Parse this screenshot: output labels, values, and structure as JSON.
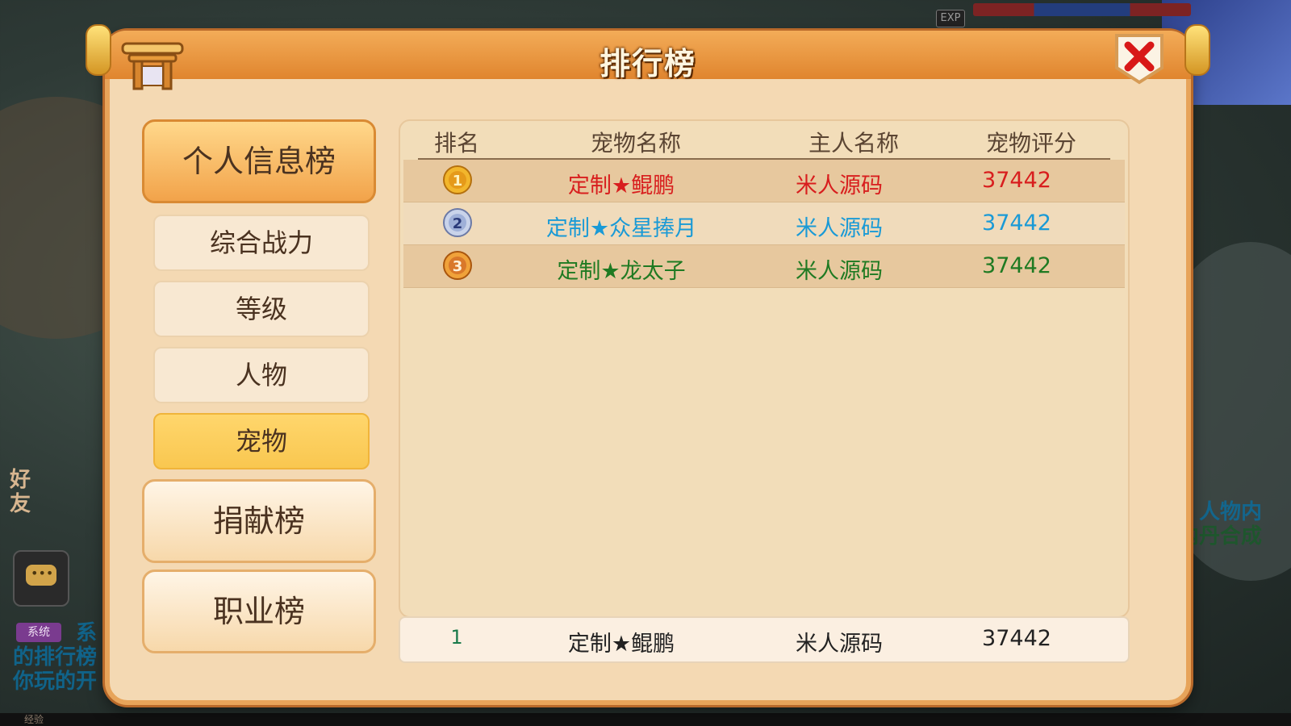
{
  "dialog": {
    "title": "排行榜"
  },
  "nav": {
    "personal_label": "个人信息榜",
    "sub_items": [
      "综合战力",
      "等级",
      "人物",
      "宠物"
    ],
    "active_sub": "宠物",
    "donation_label": "捐献榜",
    "career_label": "职业榜"
  },
  "table": {
    "headers": [
      "排名",
      "宠物名称",
      "主人名称",
      "宠物评分"
    ],
    "rows": [
      {
        "rank": "1",
        "pet": "定制★鲲鹏",
        "owner": "米人源码",
        "score": "37442",
        "color": "#d81e1e",
        "medal": "gold"
      },
      {
        "rank": "2",
        "pet": "定制★众星捧月",
        "owner": "米人源码",
        "score": "37442",
        "color": "#1a9ad6",
        "medal": "silver"
      },
      {
        "rank": "3",
        "pet": "定制★龙太子",
        "owner": "米人源码",
        "score": "37442",
        "color": "#1f7a22",
        "medal": "bronze"
      }
    ]
  },
  "my_rank": {
    "rank": "1",
    "pet": "定制★鲲鹏",
    "owner": "米人源码",
    "score": "37442"
  },
  "background": {
    "exp_badge": "EXP",
    "friend_label": "好友",
    "system_badge": "系统",
    "left_text": [
      "系",
      "的排行榜",
      "你玩的开"
    ],
    "right_text": [
      "人物内",
      "内丹合成"
    ],
    "bottom_exp": "经验"
  },
  "colors": {
    "accent": "#e0852e",
    "panel": "#f4d9b3",
    "active_tab": "#f9c750"
  }
}
